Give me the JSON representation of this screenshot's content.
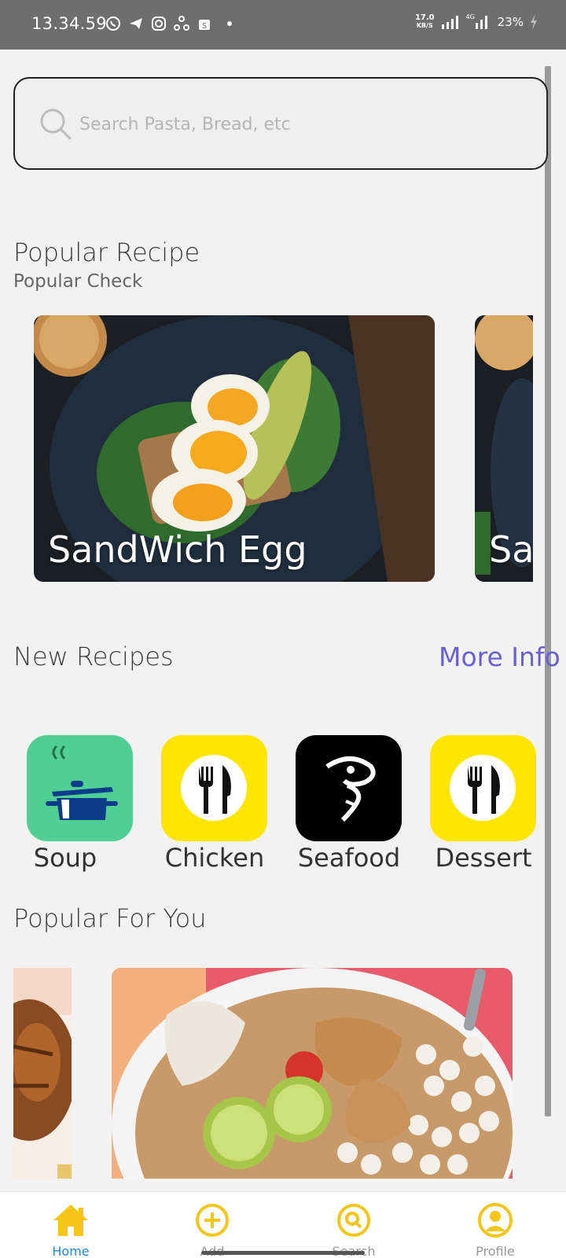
{
  "status_bar": {
    "time": "13.34.59",
    "net_speed_value": "17.0",
    "net_speed_unit": "KB/S",
    "network": "4G",
    "battery": "23%",
    "icons": [
      "whatsapp-icon",
      "telegram-icon",
      "instagram-icon",
      "sync-icon",
      "shop-icon"
    ]
  },
  "search": {
    "placeholder": "Search Pasta, Bread, etc"
  },
  "popular_recipe": {
    "title": "Popular Recipe",
    "subtitle": "Popular Check",
    "cards": [
      {
        "label": "SandWich Egg"
      },
      {
        "label": "Sa"
      }
    ]
  },
  "new_recipes": {
    "title": "New Recipes",
    "more_label": "More Info",
    "categories": [
      {
        "label": "Soup",
        "icon": "cooking-pot-icon",
        "color": "#4fcf93"
      },
      {
        "label": "Chicken",
        "icon": "fork-knife-icon",
        "color": "#ffe600"
      },
      {
        "label": "Seafood",
        "icon": "fish-icon",
        "color": "#000000"
      },
      {
        "label": "Dessert",
        "icon": "fork-knife-icon",
        "color": "#ffe600"
      }
    ]
  },
  "popular_for_you": {
    "title": "Popular For You"
  },
  "bottom_nav": {
    "items": [
      {
        "label": "Home",
        "icon": "home-icon",
        "active": true
      },
      {
        "label": "Add",
        "icon": "add-circle-icon",
        "active": false
      },
      {
        "label": "Search",
        "icon": "search-circle-icon",
        "active": false
      },
      {
        "label": "Profile",
        "icon": "profile-icon",
        "active": false
      }
    ],
    "accent_color": "#f5c518",
    "active_label_color": "#1e88e5"
  }
}
